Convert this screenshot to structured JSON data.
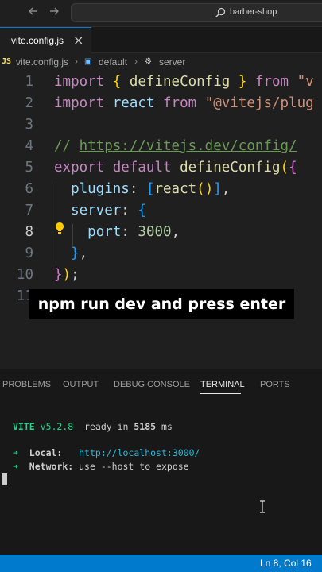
{
  "titlebar": {
    "search_text": "barber-shop",
    "back_icon": "arrow-left-icon",
    "forward_icon": "arrow-right-icon",
    "search_icon": "search-icon"
  },
  "tab": {
    "label": "vite.config.js",
    "close_icon": "close-icon"
  },
  "breadcrumb": {
    "file": "vite.config.js",
    "symbol": "default",
    "property": "server"
  },
  "editor": {
    "active_line": 8,
    "line_numbers": [
      "1",
      "2",
      "3",
      "4",
      "5",
      "6",
      "7",
      "8",
      "9",
      "10",
      "11"
    ],
    "lines": [
      "import { defineConfig } from 'vite'",
      "import react from '@vitejs/plugin-react'",
      "",
      "// https://vitejs.dev/config/",
      "export default defineConfig({",
      "  plugins: [react()],",
      "  server: {",
      "    port: 3000,",
      "  },",
      "});",
      ""
    ],
    "tokens": {
      "import": "import",
      "from": "from",
      "open_brace": "{",
      "close_brace": "}",
      "defineConfig": "defineConfig",
      "react": "react",
      "vite_str": "\"v",
      "plugin_str": "\"@vitejs/plug",
      "comment_slashes": "//",
      "comment_url": "https://vitejs.dev/config/",
      "export": "export",
      "default": "default",
      "open_paren": "(",
      "close_paren": ")",
      "plugins": "plugins",
      "colon": ":",
      "open_bracket": "[",
      "close_bracket": "]",
      "comma": ",",
      "server": "server",
      "port": "port",
      "port_value": "3000",
      "semicolon": ";"
    }
  },
  "caption": "npm run dev and press enter",
  "panel": {
    "tabs": [
      "PROBLEMS",
      "OUTPUT",
      "DEBUG CONSOLE",
      "TERMINAL",
      "PORTS"
    ],
    "active_tab": "TERMINAL"
  },
  "terminal": {
    "vite_label": "VITE",
    "version": "v5.2.8",
    "ready_text": "ready in",
    "ready_ms": "5185",
    "ms_unit": "ms",
    "arrow": "➜",
    "local_label": "Local:",
    "local_url": "http://localhost:3000/",
    "network_label": "Network:",
    "network_text": "use --host to expose"
  },
  "statusbar": {
    "position": "Ln 8, Col 16"
  },
  "colors": {
    "status_bar": "#007acc",
    "keyword": "#c586c0",
    "function": "#dcdcaa",
    "string": "#ce9178",
    "comment": "#6a9955",
    "terminal_green": "#23d18b",
    "terminal_cyan": "#29b8db"
  }
}
